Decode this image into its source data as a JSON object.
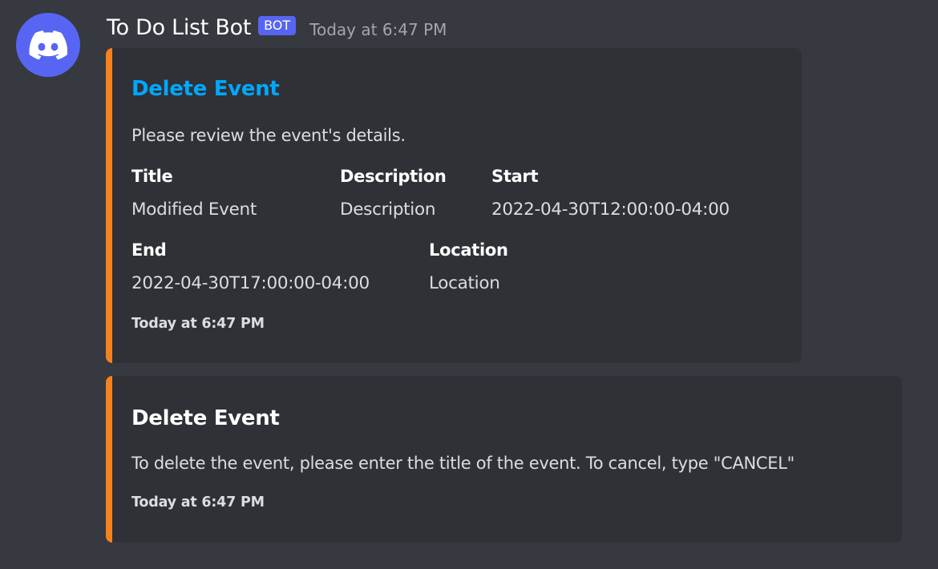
{
  "message": {
    "author": "To Do List Bot",
    "bot_tag": "BOT",
    "timestamp": "Today at 6:47 PM",
    "avatar_icon": "discord-logo-icon",
    "colors": {
      "background": "#36393f",
      "embed_background": "#2f3136",
      "embed_accent": "#f5811f",
      "title_link": "#00a8fc",
      "bot_tag": "#5865f2"
    }
  },
  "embeds": [
    {
      "title": "Delete Event",
      "description": "Please review the event's details.",
      "fields": [
        {
          "name": "Title",
          "value": "Modified Event"
        },
        {
          "name": "Description",
          "value": "Description"
        },
        {
          "name": "Start",
          "value": "2022-04-30T12:00:00-04:00"
        },
        {
          "name": "End",
          "value": "2022-04-30T17:00:00-04:00"
        },
        {
          "name": "Location",
          "value": "Location"
        }
      ],
      "footer": "Today at 6:47 PM"
    },
    {
      "title": "Delete Event",
      "description": "To delete the event, please enter the title of the event. To cancel, type \"CANCEL\"",
      "footer": "Today at 6:47 PM"
    }
  ]
}
